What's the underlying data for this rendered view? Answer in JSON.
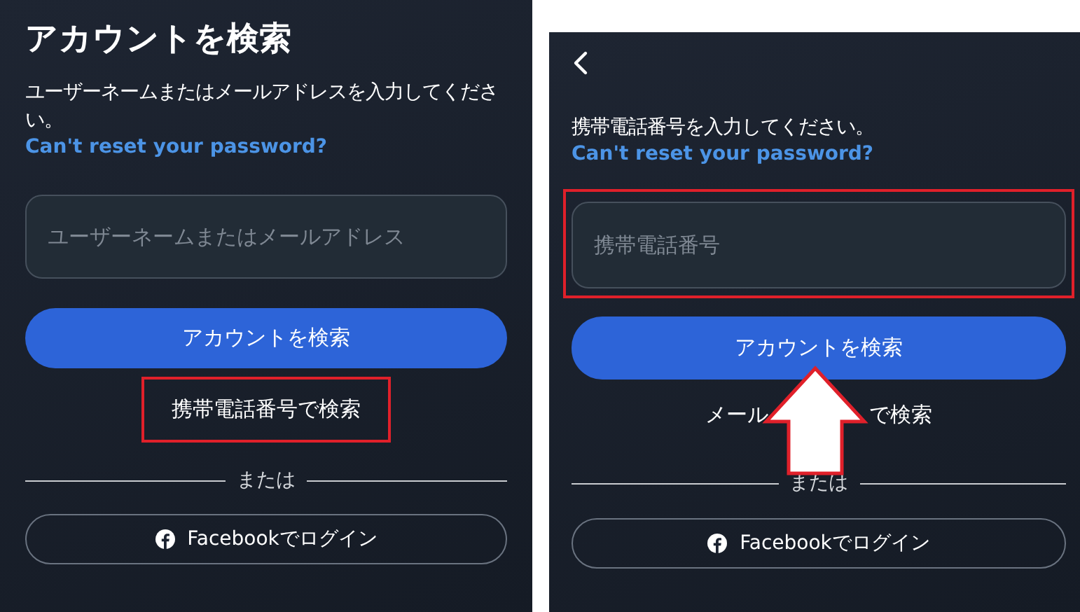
{
  "panels": [
    {
      "back": false,
      "title": "アカウントを検索",
      "instruction": "ユーザーネームまたはメールアドレスを入力してください。",
      "help_link": "Can't reset your password?",
      "field": {
        "placeholder": "ユーザーネームまたはメールアドレス",
        "highlighted": false
      },
      "search_button": {
        "label": "アカウントを検索",
        "pointed_at": false
      },
      "alt_link": {
        "label": "携帯電話番号で検索",
        "highlighted": true
      },
      "divider": "または",
      "facebook_button": "Facebookでログイン"
    },
    {
      "back": true,
      "instruction": "携帯電話番号を入力してください。",
      "help_link": "Can't reset your password?",
      "field": {
        "placeholder": "携帯電話番号",
        "highlighted": true
      },
      "search_button": {
        "label": "アカウントを検索",
        "pointed_at": true
      },
      "alt_link": {
        "label": "メール",
        "label_after_arrow": "で検索",
        "highlighted": false
      },
      "divider": "または",
      "facebook_button": "Facebookでログイン"
    }
  ]
}
